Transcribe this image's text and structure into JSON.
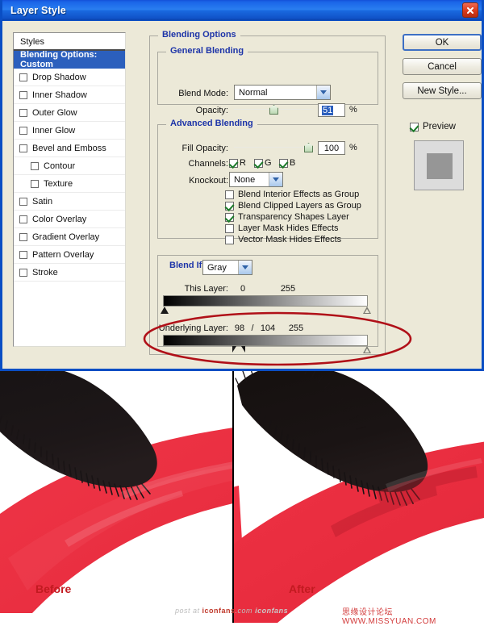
{
  "window": {
    "title": "Layer Style",
    "close_icon": "close-icon"
  },
  "styles_panel": {
    "header": "Styles",
    "items": [
      {
        "label": "Blending Options: Custom",
        "selected": true,
        "checkbox": false,
        "indent": false
      },
      {
        "label": "Drop Shadow",
        "selected": false,
        "checkbox": true,
        "checked": false,
        "indent": false
      },
      {
        "label": "Inner Shadow",
        "selected": false,
        "checkbox": true,
        "checked": false,
        "indent": false
      },
      {
        "label": "Outer Glow",
        "selected": false,
        "checkbox": true,
        "checked": false,
        "indent": false
      },
      {
        "label": "Inner Glow",
        "selected": false,
        "checkbox": true,
        "checked": false,
        "indent": false
      },
      {
        "label": "Bevel and Emboss",
        "selected": false,
        "checkbox": true,
        "checked": false,
        "indent": false
      },
      {
        "label": "Contour",
        "selected": false,
        "checkbox": true,
        "checked": false,
        "indent": true
      },
      {
        "label": "Texture",
        "selected": false,
        "checkbox": true,
        "checked": false,
        "indent": true
      },
      {
        "label": "Satin",
        "selected": false,
        "checkbox": true,
        "checked": false,
        "indent": false
      },
      {
        "label": "Color Overlay",
        "selected": false,
        "checkbox": true,
        "checked": false,
        "indent": false
      },
      {
        "label": "Gradient Overlay",
        "selected": false,
        "checkbox": true,
        "checked": false,
        "indent": false
      },
      {
        "label": "Pattern Overlay",
        "selected": false,
        "checkbox": true,
        "checked": false,
        "indent": false
      },
      {
        "label": "Stroke",
        "selected": false,
        "checkbox": true,
        "checked": false,
        "indent": false
      }
    ]
  },
  "blending_options": {
    "group_label": "Blending Options",
    "general": {
      "group_label": "General Blending",
      "blend_mode_label": "Blend Mode:",
      "blend_mode_value": "Normal",
      "opacity_label": "Opacity:",
      "opacity_value": "51",
      "opacity_unit": "%"
    },
    "advanced": {
      "group_label": "Advanced Blending",
      "fill_opacity_label": "Fill Opacity:",
      "fill_opacity_value": "100",
      "fill_opacity_unit": "%",
      "channels_label": "Channels:",
      "channels": [
        {
          "label": "R",
          "checked": true
        },
        {
          "label": "G",
          "checked": true
        },
        {
          "label": "B",
          "checked": true
        }
      ],
      "knockout_label": "Knockout:",
      "knockout_value": "None",
      "options": [
        {
          "label": "Blend Interior Effects as Group",
          "checked": false
        },
        {
          "label": "Blend Clipped Layers as Group",
          "checked": true
        },
        {
          "label": "Transparency Shapes Layer",
          "checked": true
        },
        {
          "label": "Layer Mask Hides Effects",
          "checked": false
        },
        {
          "label": "Vector Mask Hides Effects",
          "checked": false
        }
      ]
    },
    "blend_if": {
      "group_label": "Blend If:",
      "channel_value": "Gray",
      "this_layer_label": "This Layer:",
      "this_layer_low": "0",
      "this_layer_high": "255",
      "underlying_label": "Underlying Layer:",
      "underlying_low_a": "98",
      "underlying_separator": "/",
      "underlying_low_b": "104",
      "underlying_high": "255"
    }
  },
  "buttons": {
    "ok": "OK",
    "cancel": "Cancel",
    "new_style": "New Style...",
    "preview_label": "Preview",
    "preview_checked": true
  },
  "comparison": {
    "before_label": "Before",
    "after_label": "After",
    "watermark_left_prefix": "post at ",
    "watermark_left_brand": "iconfans",
    "watermark_left_suffix": ".com ",
    "watermark_left_logo": "iconfans",
    "watermark_right": "思缘设计论坛  WWW.MISSYUAN.COM"
  },
  "colors": {
    "titlebar_blue": "#2a7ff0",
    "dialog_border": "#0a4ec4",
    "selection_blue": "#2b5fbd",
    "group_label_blue": "#1d34a8",
    "annotation_red": "#b01018",
    "paint_red": "#ef3647",
    "label_red": "#c21a20"
  }
}
